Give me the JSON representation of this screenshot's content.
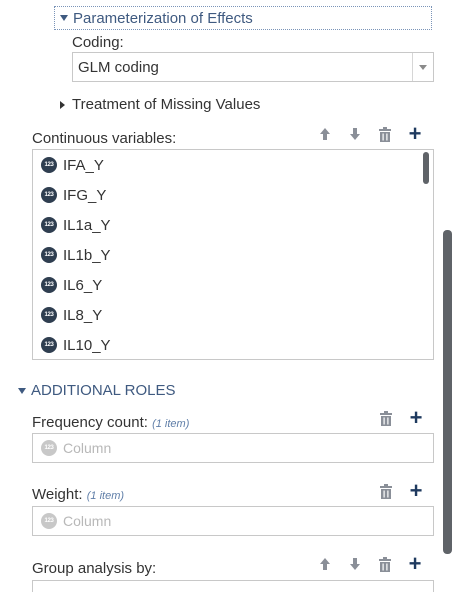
{
  "parameterization": {
    "label": "Parameterization of Effects"
  },
  "coding": {
    "label": "Coding:",
    "value": "GLM coding"
  },
  "missing_values": {
    "label": "Treatment of Missing Values"
  },
  "continuous": {
    "label": "Continuous variables:",
    "items": [
      "IFA_Y",
      "IFG_Y",
      "IL1a_Y",
      "IL1b_Y",
      "IL6_Y",
      "IL8_Y",
      "IL10_Y"
    ]
  },
  "badge_text": "123",
  "additional_roles": {
    "label": "ADDITIONAL ROLES"
  },
  "frequency": {
    "label": "Frequency count:",
    "count": "(1 item)",
    "placeholder": "Column"
  },
  "weight": {
    "label": "Weight:",
    "count": "(1 item)",
    "placeholder": "Column"
  },
  "group_by": {
    "label": "Group analysis by:"
  },
  "colors": {
    "accent": "#3f5a80",
    "badge": "#2f3e50",
    "border": "#c8c8c8",
    "plus": "#1f3a5f"
  },
  "icons": {
    "move_up": "arrow-up-icon",
    "move_down": "arrow-down-icon",
    "delete": "trash-icon",
    "add": "plus-icon",
    "numeric": "numeric-badge-icon"
  }
}
